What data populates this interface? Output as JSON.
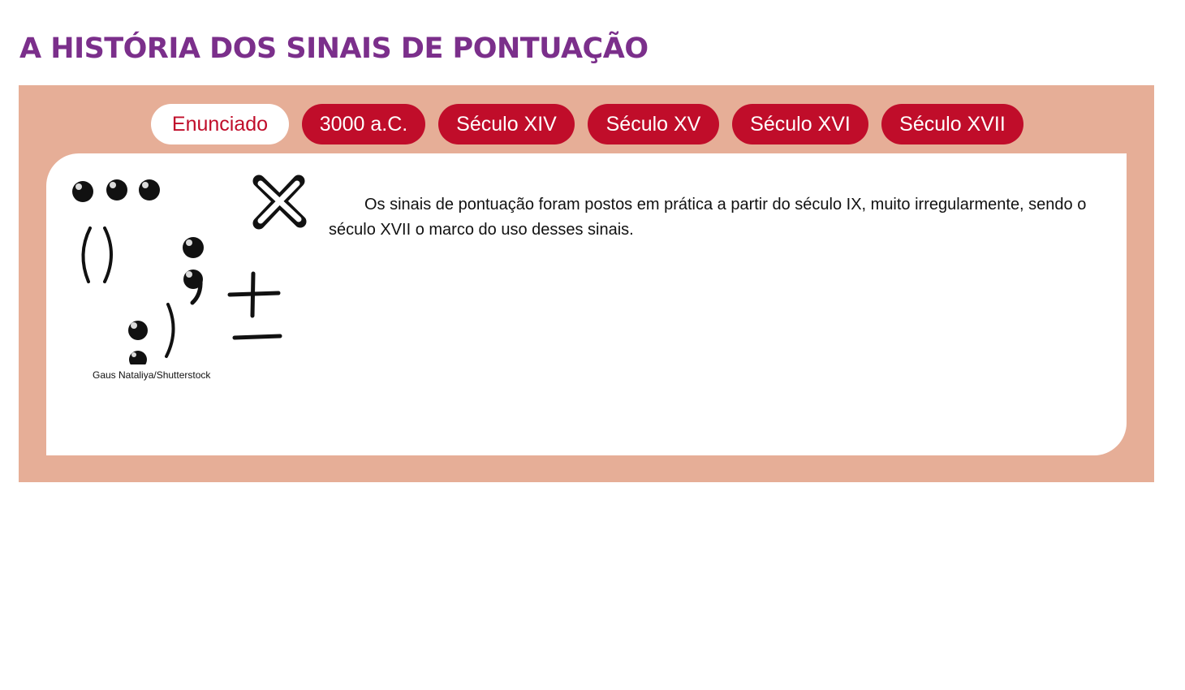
{
  "page": {
    "title": "A HISTÓRIA DOS SINAIS DE PONTUAÇÃO"
  },
  "colors": {
    "title": "#7b2f8b",
    "frame_bg": "#e6ae97",
    "tab_active_bg": "#ffffff",
    "tab_active_text": "#c00d2a",
    "tab_bg": "#c00d2a",
    "tab_text": "#ffffff"
  },
  "tabs": [
    {
      "label": "Enunciado",
      "active": true
    },
    {
      "label": "3000 a.C.",
      "active": false
    },
    {
      "label": "Século XIV",
      "active": false
    },
    {
      "label": "Século XV",
      "active": false
    },
    {
      "label": "Século XVI",
      "active": false
    },
    {
      "label": "Século XVII",
      "active": false
    }
  ],
  "content": {
    "image_icon": "punctuation-marks-illustration",
    "image_credit": "Gaus Nataliya/Shutterstock",
    "paragraph": "Os sinais de pontuação foram postos em prática a partir do século IX, muito irregularmente, sendo o século XVII o marco do uso desses sinais."
  }
}
